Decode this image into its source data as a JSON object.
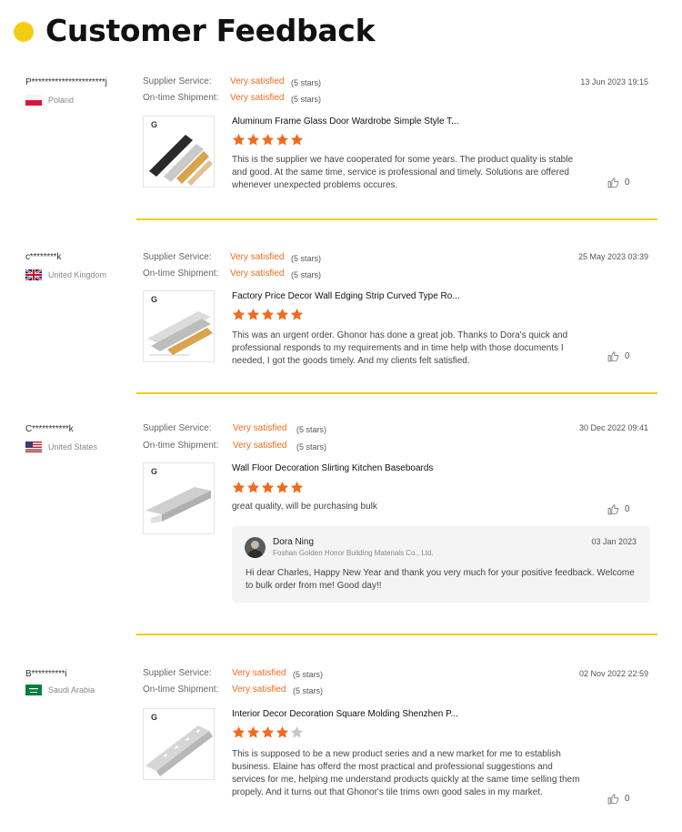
{
  "header": {
    "title": "Customer Feedback"
  },
  "labels": {
    "supplier_service": "Supplier Service:",
    "ontime_shipment": "On-time Shipment:"
  },
  "colors": {
    "accent": "#f5cc14",
    "rating_text": "#f26b1d",
    "star": "#f26b1d",
    "star_empty": "#c8c8c8"
  },
  "reviews": [
    {
      "user": "P**********************j",
      "country": "Poland",
      "flag": "poland-flag",
      "supplier_service": "Very satisfied",
      "supplier_stars": "(5 stars)",
      "ontime_shipment": "Very satisfied",
      "ontime_stars": "(5 stars)",
      "date": "13 Jun 2023 19:15",
      "product_title": "Aluminum Frame Glass Door Wardrobe Simple Style T...",
      "rating": 5,
      "text": "This is the supplier we have cooperated for some years. The product quality is stable and good. At the same time, service is professional and timely. Solutions are offered whenever unexpected problems occures.",
      "likes": "0"
    },
    {
      "user": "c********k",
      "country": "United Kingdom",
      "flag": "uk-flag",
      "supplier_service": "Very satisfied",
      "supplier_stars": "(5 stars)",
      "ontime_shipment": "Very satisfied",
      "ontime_stars": "(5 stars)",
      "date": "25 May 2023 03:39",
      "product_title": "Factory Price Decor Wall Edging Strip Curved Type Ro...",
      "rating": 5,
      "text": "This was an urgent order. Ghonor has done a great job. Thanks to Dora's quick and professional responds to my requirements and in time help with those documents I needed, I got the goods timely. And my clients felt satisfied.",
      "likes": "0"
    },
    {
      "user": "C***********k",
      "country": "United States",
      "flag": "us-flag",
      "supplier_service": "Very satisfied",
      "supplier_stars": "(5 stars)",
      "ontime_shipment": "Very satisfied",
      "ontime_stars": "(5 stars)",
      "date": "30 Dec 2022 09:41",
      "product_title": "Wall Floor Decoration Slirting Kitchen Baseboards",
      "rating": 5,
      "text": "great quality, will be purchasing bulk",
      "likes": "0",
      "reply": {
        "name": "Dora Ning",
        "company": "Foshan Golden Honor Building Materials Co., Ltd.",
        "date": "03 Jan 2023",
        "text": "Hi dear Charles, Happy New Year and thank you very much for your positive feedback. Welcome to bulk order from me!  Good day!!"
      }
    },
    {
      "user": "B**********i",
      "country": "Saudi Arabia",
      "flag": "saudi-arabia-flag",
      "supplier_service": "Very satisfied",
      "supplier_stars": "(5 stars)",
      "ontime_shipment": "Very satisfied",
      "ontime_stars": "(5 stars)",
      "date": "02 Nov 2022 22:59",
      "product_title": "Interior Decor Decoration Square Molding Shenzhen P...",
      "rating": 4,
      "text": "This is supposed to be a new product series and a new market for me to establish business. Elaine has offerd the most practical and professional suggestions and services for me, helping me understand products quickly at the same time selling them propely. And it turns out that Ghonor's tile trims own good sales in my market.",
      "likes": "0"
    }
  ]
}
